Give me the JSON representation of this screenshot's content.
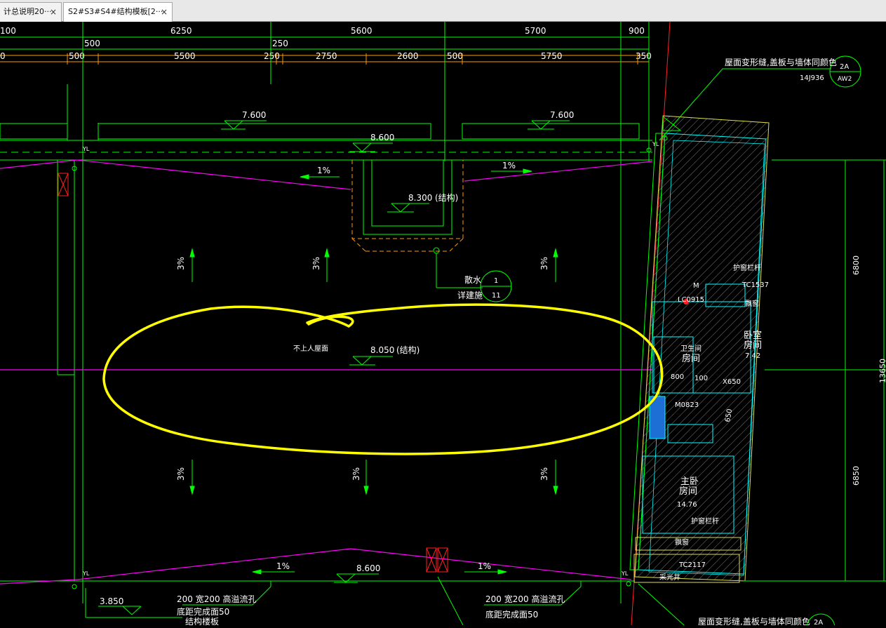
{
  "tabs": [
    {
      "label": "计总说明20···",
      "close": "×"
    },
    {
      "label": "S2#S3#S4#结构模板[2···",
      "close": "×"
    }
  ],
  "drawing": {
    "dims_top": [
      "100",
      "6250",
      "5600",
      "5700",
      "900"
    ],
    "dims_second": [
      "0",
      "500",
      "5500",
      "250",
      "2750",
      "2600",
      "500",
      "5750",
      "350"
    ],
    "dims_offsets": [
      "500",
      "250"
    ],
    "elevations": {
      "e7600_left": "7.600",
      "e7600_right": "7.600",
      "e8600_top": "8.600",
      "e8300": "8.300",
      "e8300_note": "(结构)",
      "e8050": "8.050",
      "e8050_note": "(结构)",
      "e8600_bottom": "8.600",
      "e3850": "3.850"
    },
    "slopes": [
      "1%",
      "1%",
      "3%",
      "3%",
      "3%",
      "3%",
      "3%",
      "3%",
      "1%",
      "1%"
    ],
    "labels": {
      "yl": "YL",
      "roof_note": "不上人屋面",
      "drain_1": "散水",
      "drain_2": "详建施",
      "ref_top": "1",
      "ref_bottom": "11",
      "callout_top": "屋面变形缝,盖板与墙体同颜色",
      "callout_top_std": "14J936",
      "callout_ref_a": "2A",
      "callout_ref_b": "AW2",
      "callout_bottom": "屋面变形缝,盖板与墙体同颜色",
      "callout_bottom_ref": "2A",
      "overflow_1": "200 宽200 高溢流孔",
      "overflow_1b": "底距完成面50",
      "overflow_1c": "结构楼板",
      "overflow_2": "200 宽200 高溢流孔",
      "overflow_2b": "底距完成面50",
      "rail_1": "护窗栏杆",
      "rail_2": "护窗栏杆",
      "win_tc": "TC1537",
      "win_tc2": "TC2117",
      "bay_1": "飘窗",
      "bay_2": "飘窗",
      "lc": "LC0915",
      "m": "M",
      "room_1": "卧室",
      "room_1b": "房间",
      "room_1_area": "7.42",
      "bath": "卫生间",
      "bath_b": "房间",
      "area_x": "X650",
      "door": "M0823",
      "room_2": "主卧",
      "room_2b": "房间",
      "room_2_area": "14.76",
      "light_well": "采光井",
      "num_650": "650",
      "num_100": "100",
      "num_800": "800",
      "right_dim_1": "6800",
      "right_dim_2": "6850",
      "right_dim_total": "13650"
    }
  },
  "colors": {
    "grid": "#00ff00",
    "cyan": "#00ffff",
    "magenta": "#ff00ff",
    "yellow": "#ffff00",
    "white": "#ffffff",
    "orange": "#ff9900",
    "red": "#ff2020"
  },
  "icons": [
    "close-icon",
    "elevation-marker-icon",
    "slope-arrow-icon",
    "reference-circle-icon"
  ]
}
